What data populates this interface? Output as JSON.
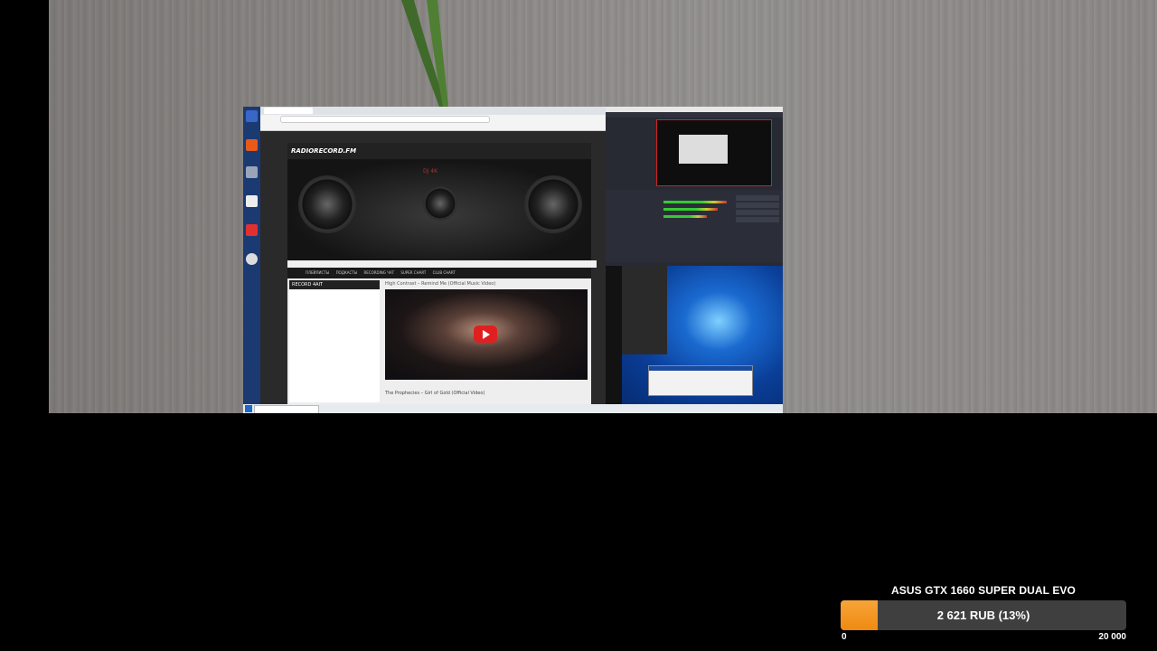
{
  "stream": {
    "donation_goal": {
      "title": "ASUS GTX 1660 SUPER DUAL EVO",
      "progress_text": "2 621 RUB (13%)",
      "progress_fraction": 0.13,
      "min_label": "0",
      "max_label": "20 000",
      "colors": {
        "fill": "#ef8a10",
        "track": "#3f3f3f",
        "text": "#ffffff"
      }
    }
  },
  "captured_screen": {
    "browser": {
      "site_logo": "RADIORECORD.FM",
      "hero_title": "DJ 4K",
      "nav_items": [
        "ПЛЕЙЛИСТЫ",
        "ПОДКАСТЫ",
        "RECORDING ЧАТ",
        "SUPER CHART",
        "CLUB CHART"
      ],
      "sidebar_heading": "RECORD 4AIT",
      "video_title": "High Contrast – Remind Me (Official Music Video)",
      "video_next": "The Prophecies – Girl of Gold (Official Video)"
    },
    "colors": {
      "obs_bg": "#272a33",
      "desktop_blue": "#1a6ad0",
      "youtube_red": "#e02020"
    }
  }
}
